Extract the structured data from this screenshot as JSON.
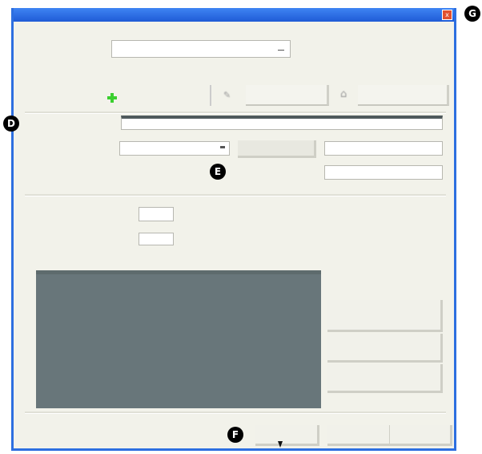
{
  "window": {
    "title": "",
    "close_glyph": "x"
  },
  "general": {
    "row1_label": "",
    "row1_value": "",
    "row2_label": "",
    "add_button_label": "",
    "edit_label": "",
    "remove_label": "",
    "description_label": "",
    "description_value": "",
    "type_label": "",
    "type_value": "",
    "right_label_1": "",
    "right_value_1": "",
    "right_label_2": "",
    "right_value_2": ""
  },
  "options": {
    "section_label": "",
    "check1_label": "",
    "check1_value": "",
    "check1_suffix": "",
    "check2_label": "",
    "check2_value": "",
    "check2_suffix": "",
    "list_label": "",
    "side_buttons": [
      "",
      "",
      ""
    ]
  },
  "footer": {
    "ok": "",
    "cancel": "",
    "help": ""
  },
  "markers": {
    "D": "D",
    "E": "E",
    "F": "F",
    "G": "G"
  },
  "colors": {
    "titlebar": "#2d6fe0",
    "list_bg": "#68767a",
    "close": "#e2502f",
    "add_icon": "#3bcf2f"
  }
}
